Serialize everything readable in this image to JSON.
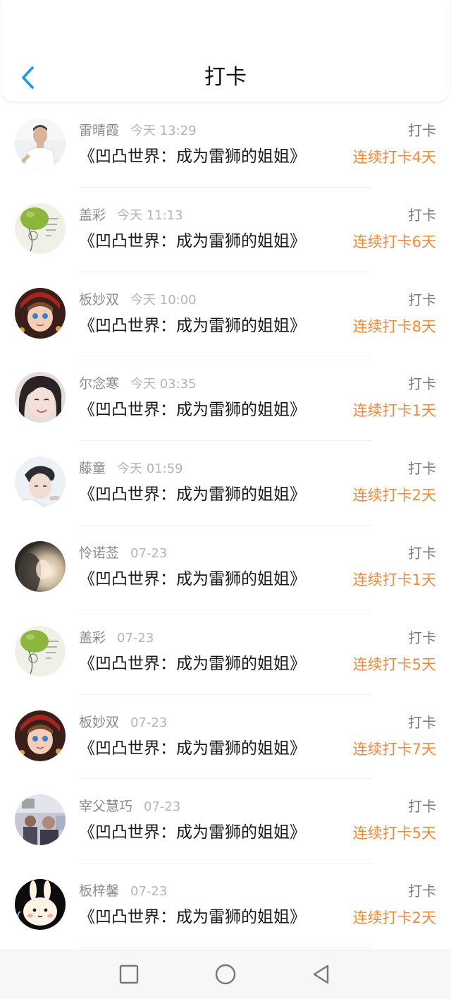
{
  "header": {
    "title": "打卡",
    "back_icon": "chevron-left-icon"
  },
  "colors": {
    "back": "#1e9bf0",
    "streak": "#f08a3c"
  },
  "items": [
    {
      "name": "雷晴霞",
      "time": "今天 13:29",
      "book": "《凹凸世界：成为雷狮的姐姐》",
      "tag": "打卡",
      "streak": "连续打卡4天",
      "avatar": "man-photo"
    },
    {
      "name": "盖彩",
      "time": "今天 11:13",
      "book": "《凹凸世界：成为雷狮的姐姐》",
      "tag": "打卡",
      "streak": "连续打卡6天",
      "avatar": "lime-sketch"
    },
    {
      "name": "板妙双",
      "time": "今天 10:00",
      "book": "《凹凸世界：成为雷狮的姐姐》",
      "tag": "打卡",
      "streak": "连续打卡8天",
      "avatar": "anime-girl"
    },
    {
      "name": "尔念寒",
      "time": "今天 03:35",
      "book": "《凹凸世界：成为雷狮的姐姐》",
      "tag": "打卡",
      "streak": "连续打卡1天",
      "avatar": "girl-smile"
    },
    {
      "name": "藤童",
      "time": "今天 01:59",
      "book": "《凹凸世界：成为雷狮的姐姐》",
      "tag": "打卡",
      "streak": "连续打卡2天",
      "avatar": "boy-photo"
    },
    {
      "name": "怜诺莶",
      "time": "07-23",
      "book": "《凹凸世界：成为雷狮的姐姐》",
      "tag": "打卡",
      "streak": "连续打卡1天",
      "avatar": "girl-light"
    },
    {
      "name": "盖彩",
      "time": "07-23",
      "book": "《凹凸世界：成为雷狮的姐姐》",
      "tag": "打卡",
      "streak": "连续打卡5天",
      "avatar": "lime-sketch"
    },
    {
      "name": "板妙双",
      "time": "07-23",
      "book": "《凹凸世界：成为雷狮的姐姐》",
      "tag": "打卡",
      "streak": "连续打卡7天",
      "avatar": "anime-girl"
    },
    {
      "name": "宰父慧巧",
      "time": "07-23",
      "book": "《凹凸世界：成为雷狮的姐姐》",
      "tag": "打卡",
      "streak": "连续打卡5天",
      "avatar": "group-photo"
    },
    {
      "name": "板梓馨",
      "time": "07-23",
      "book": "《凹凸世界：成为雷狮的姐姐》",
      "tag": "打卡",
      "streak": "连续打卡2天",
      "avatar": "rabbit-cartoon"
    }
  ],
  "navbar": {
    "buttons": [
      "recents-square-icon",
      "home-circle-icon",
      "back-triangle-icon"
    ]
  }
}
